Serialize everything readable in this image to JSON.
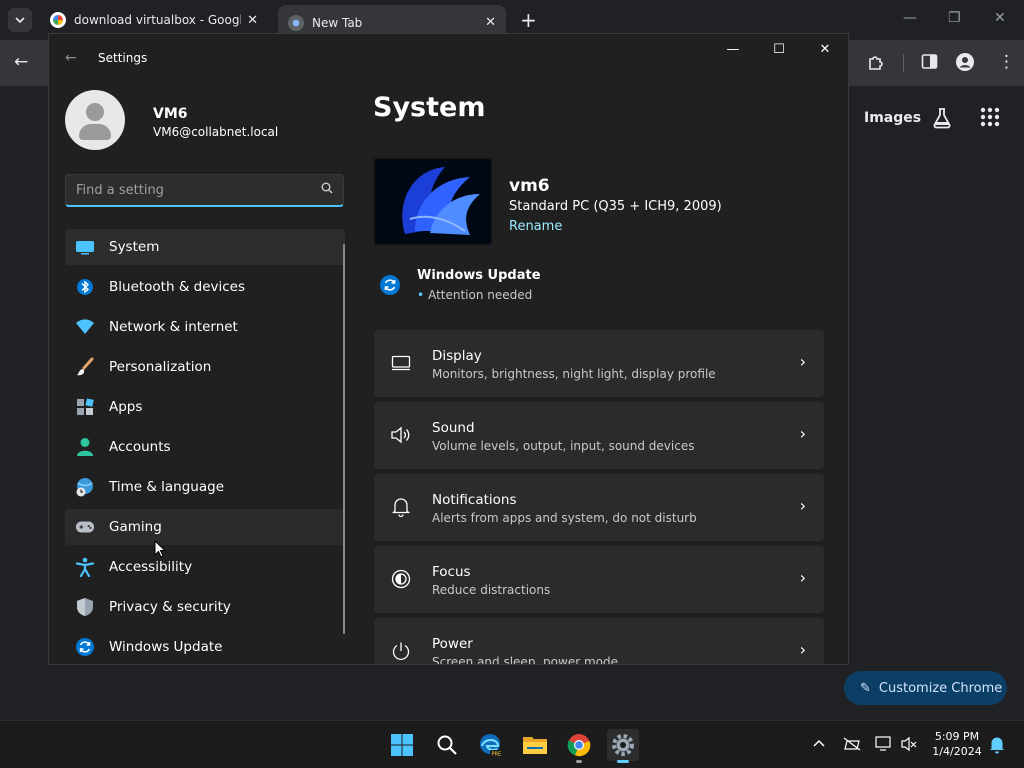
{
  "browser": {
    "tabs": [
      {
        "title": "download virtualbox - Google S",
        "close": "✕"
      },
      {
        "title": "New Tab",
        "close": "✕"
      }
    ],
    "new_tab": "+",
    "ntp": {
      "images_label": "Images",
      "customize_label": "Customize Chrome"
    },
    "colors": {
      "accent": "#0c3f66"
    }
  },
  "settings": {
    "window_title": "Settings",
    "user": {
      "name": "VM6",
      "email": "VM6@collabnet.local"
    },
    "search": {
      "placeholder": "Find a setting"
    },
    "nav": [
      {
        "label": "System",
        "icon": "monitor-icon"
      },
      {
        "label": "Bluetooth & devices",
        "icon": "bluetooth-icon"
      },
      {
        "label": "Network & internet",
        "icon": "wifi-icon"
      },
      {
        "label": "Personalization",
        "icon": "brush-icon"
      },
      {
        "label": "Apps",
        "icon": "apps-icon"
      },
      {
        "label": "Accounts",
        "icon": "person-icon"
      },
      {
        "label": "Time & language",
        "icon": "globe-clock-icon"
      },
      {
        "label": "Gaming",
        "icon": "gamepad-icon"
      },
      {
        "label": "Accessibility",
        "icon": "accessibility-icon"
      },
      {
        "label": "Privacy & security",
        "icon": "shield-icon"
      },
      {
        "label": "Windows Update",
        "icon": "update-icon"
      }
    ],
    "main": {
      "title": "System",
      "device": {
        "name": "vm6",
        "model": "Standard PC (Q35 + ICH9, 2009)",
        "rename": "Rename"
      },
      "update": {
        "title": "Windows Update",
        "status": "Attention needed"
      },
      "cards": [
        {
          "title": "Display",
          "subtitle": "Monitors, brightness, night light, display profile",
          "icon": "display-icon"
        },
        {
          "title": "Sound",
          "subtitle": "Volume levels, output, input, sound devices",
          "icon": "speaker-icon"
        },
        {
          "title": "Notifications",
          "subtitle": "Alerts from apps and system, do not disturb",
          "icon": "bell-icon"
        },
        {
          "title": "Focus",
          "subtitle": "Reduce distractions",
          "icon": "focus-icon"
        },
        {
          "title": "Power",
          "subtitle": "Screen and sleep, power mode",
          "icon": "power-icon"
        }
      ]
    }
  },
  "taskbar": {
    "time": "5:09 PM",
    "date": "1/4/2024"
  }
}
